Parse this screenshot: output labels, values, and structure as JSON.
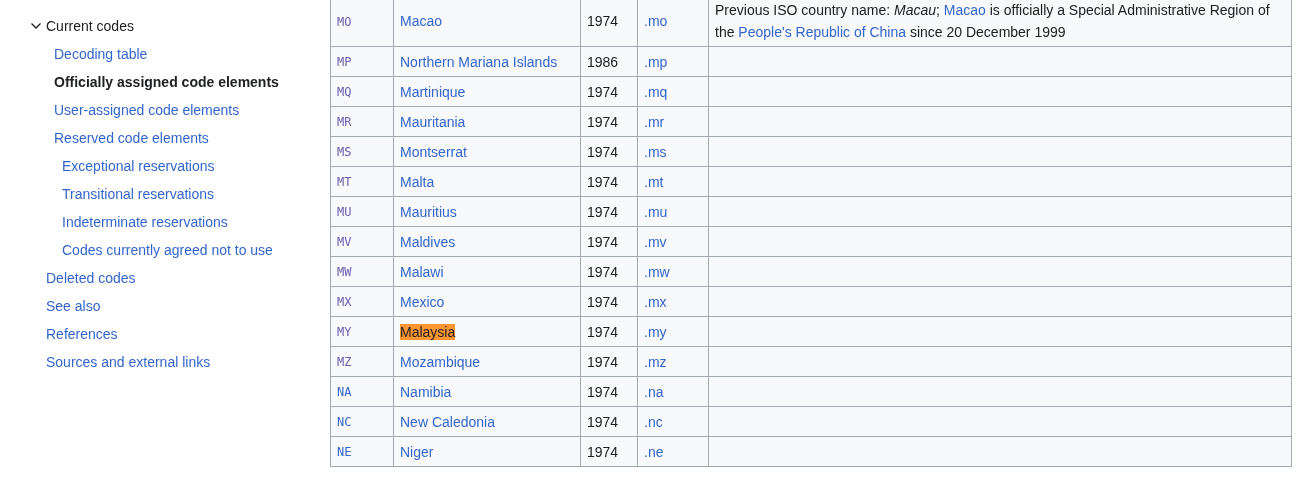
{
  "toc": [
    {
      "label": "Current codes",
      "selected": false,
      "expanded": true,
      "children": [
        {
          "label": "Decoding table",
          "selected": false
        },
        {
          "label": "Officially assigned code elements",
          "selected": true
        },
        {
          "label": "User-assigned code elements",
          "selected": false
        },
        {
          "label": "Reserved code elements",
          "selected": false,
          "children": [
            {
              "label": "Exceptional reservations",
              "selected": false
            },
            {
              "label": "Transitional reservations",
              "selected": false
            },
            {
              "label": "Indeterminate reservations",
              "selected": false
            },
            {
              "label": "Codes currently agreed not to use",
              "selected": false
            }
          ]
        }
      ]
    },
    {
      "label": "Deleted codes",
      "selected": false
    },
    {
      "label": "See also",
      "selected": false
    },
    {
      "label": "References",
      "selected": false
    },
    {
      "label": "Sources and external links",
      "selected": false
    }
  ],
  "table": {
    "rows": [
      {
        "code": "MO",
        "visited": true,
        "name": "Macao",
        "highlighted": false,
        "year": "1974",
        "tld": ".mo",
        "notes": [
          {
            "kind": "text",
            "text": "Previous ISO country name: *Macau*; "
          },
          {
            "kind": "link",
            "text": "Macao"
          },
          {
            "kind": "text",
            "text": " is officially a Special Administrative Region of the "
          },
          {
            "kind": "link",
            "text": "People's Republic of China"
          },
          {
            "kind": "text",
            "text": " since 20 December 1999"
          }
        ]
      },
      {
        "code": "MP",
        "visited": true,
        "name": "Northern Mariana Islands",
        "highlighted": false,
        "year": "1986",
        "tld": ".mp"
      },
      {
        "code": "MQ",
        "visited": true,
        "name": "Martinique",
        "highlighted": false,
        "year": "1974",
        "tld": ".mq"
      },
      {
        "code": "MR",
        "visited": true,
        "name": "Mauritania",
        "highlighted": false,
        "year": "1974",
        "tld": ".mr"
      },
      {
        "code": "MS",
        "visited": true,
        "name": "Montserrat",
        "highlighted": false,
        "year": "1974",
        "tld": ".ms"
      },
      {
        "code": "MT",
        "visited": true,
        "name": "Malta",
        "highlighted": false,
        "year": "1974",
        "tld": ".mt"
      },
      {
        "code": "MU",
        "visited": true,
        "name": "Mauritius",
        "highlighted": false,
        "year": "1974",
        "tld": ".mu"
      },
      {
        "code": "MV",
        "visited": true,
        "name": "Maldives",
        "highlighted": false,
        "year": "1974",
        "tld": ".mv"
      },
      {
        "code": "MW",
        "visited": true,
        "name": "Malawi",
        "highlighted": false,
        "year": "1974",
        "tld": ".mw"
      },
      {
        "code": "MX",
        "visited": true,
        "name": "Mexico",
        "highlighted": false,
        "year": "1974",
        "tld": ".mx"
      },
      {
        "code": "MY",
        "visited": true,
        "name": "Malaysia",
        "highlighted": true,
        "year": "1974",
        "tld": ".my"
      },
      {
        "code": "MZ",
        "visited": true,
        "name": "Mozambique",
        "highlighted": false,
        "year": "1974",
        "tld": ".mz"
      },
      {
        "code": "NA",
        "visited": false,
        "name": "Namibia",
        "highlighted": false,
        "year": "1974",
        "tld": ".na"
      },
      {
        "code": "NC",
        "visited": false,
        "name": "New Caledonia",
        "highlighted": false,
        "year": "1974",
        "tld": ".nc"
      },
      {
        "code": "NE",
        "visited": false,
        "name": "Niger",
        "highlighted": false,
        "year": "1974",
        "tld": ".ne"
      }
    ]
  }
}
